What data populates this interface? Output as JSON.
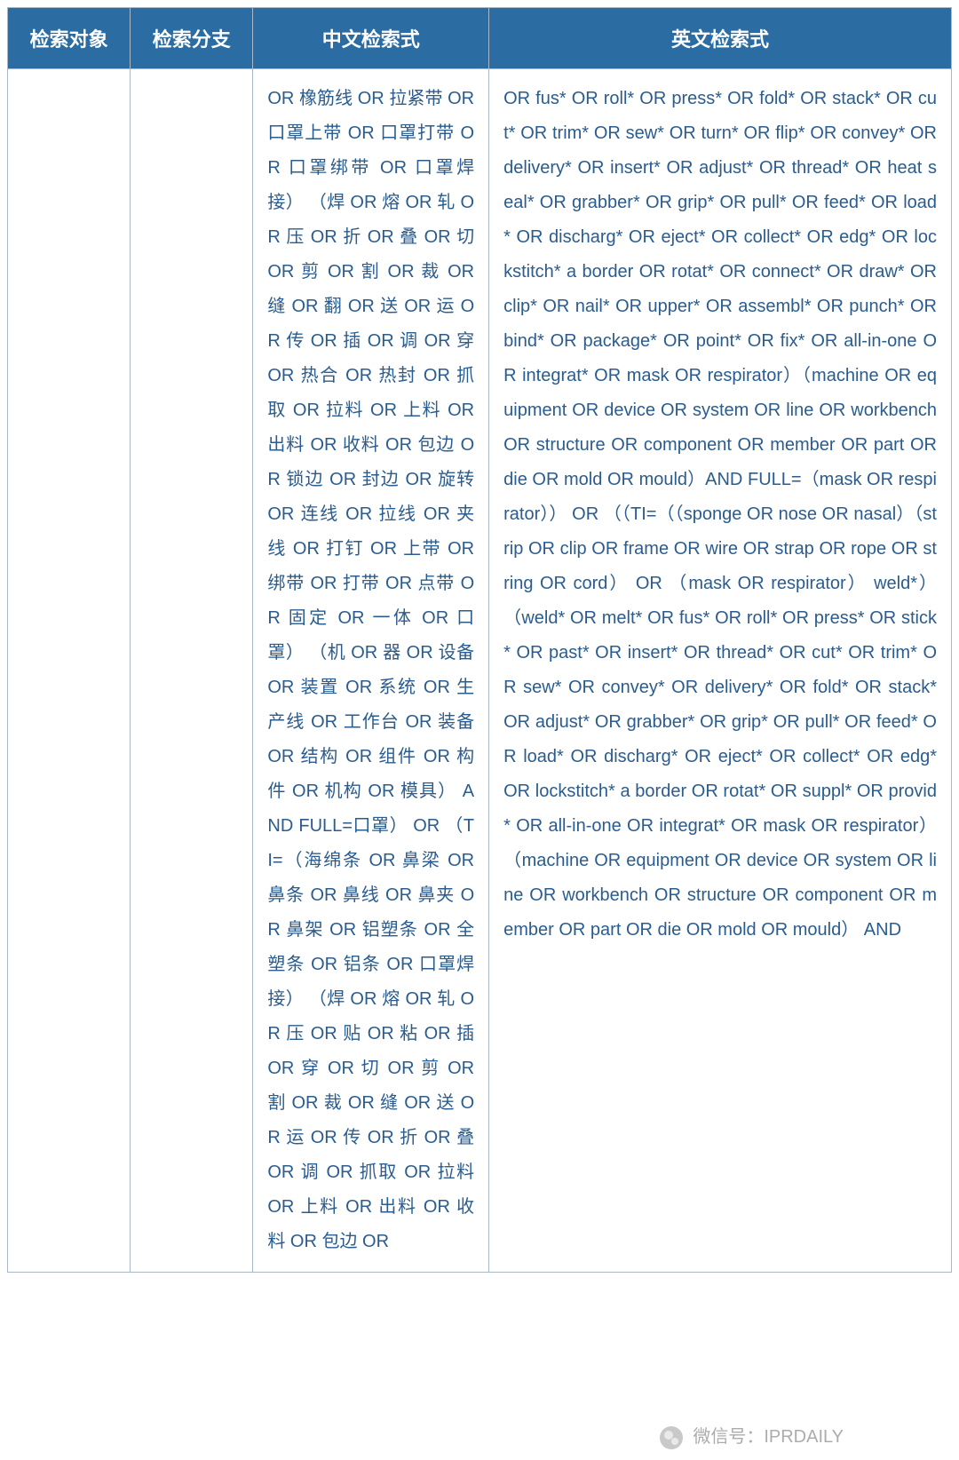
{
  "headers": {
    "col1": "检索对象",
    "col2": "检索分支",
    "col3": "中文检索式",
    "col4": "英文检索式"
  },
  "content": {
    "col1": "",
    "col2": "",
    "col3": "OR 橡筋线 OR 拉紧带 OR 口罩上带 OR 口罩打带 OR 口罩绑带 OR 口罩焊接） （焊 OR 熔 OR 轧 OR 压 OR 折 OR 叠 OR 切 OR 剪 OR 割 OR 裁 OR 缝 OR 翻 OR 送 OR 运 OR 传 OR 插 OR 调 OR 穿 OR 热合 OR 热封 OR 抓取 OR 拉料 OR 上料 OR 出料 OR 收料 OR 包边 OR 锁边 OR 封边 OR 旋转 OR 连线 OR 拉线 OR 夹线 OR 打钉 OR 上带 OR 绑带 OR 打带 OR 点带 OR 固定 OR 一体 OR 口罩） （机 OR 器 OR 设备 OR 装置 OR 系统 OR 生产线 OR 工作台 OR 装备 OR 结构 OR 组件 OR 构件 OR 机构 OR 模具） AND FULL=口罩） OR （TI=（海绵条 OR 鼻梁 OR 鼻条 OR 鼻线 OR 鼻夹 OR 鼻架 OR 铝塑条 OR 全塑条 OR 铝条 OR 口罩焊接） （焊 OR 熔 OR 轧 OR 压 OR 贴 OR 粘 OR 插 OR 穿 OR 切 OR 剪 OR 割 OR 裁 OR 缝 OR 送 OR 运 OR 传 OR 折 OR 叠 OR 调 OR 抓取 OR 拉料 OR 上料 OR 出料 OR 收料 OR 包边 OR",
    "col4": "OR fus* OR roll* OR press* OR fold* OR stack* OR cut* OR trim* OR sew* OR turn* OR flip* OR convey* OR delivery* OR insert* OR adjust* OR thread* OR heat seal* OR grabber* OR grip* OR pull* OR feed* OR load* OR discharg* OR eject* OR collect* OR edg* OR lockstitch* a border OR rotat* OR connect* OR draw* OR clip* OR nail* OR upper* OR assembl* OR punch* OR bind* OR package* OR point* OR fix* OR all-in-one OR integrat* OR mask OR respirator）（machine OR equipment OR device OR system OR line OR workbench OR structure OR component OR member OR part OR die OR mold OR mould）AND FULL=（mask OR respirator）） OR （（TI=（（sponge OR nose OR nasal）（strip OR clip OR frame OR wire OR strap OR rope OR string OR cord） OR （mask OR respirator） weld*） （weld* OR melt* OR fus* OR roll* OR press* OR stick* OR past* OR insert* OR thread* OR cut* OR trim* OR sew* OR convey* OR delivery* OR fold* OR stack* OR adjust* OR grabber* OR grip* OR pull* OR feed* OR load* OR discharg* OR eject* OR collect* OR edg* OR lockstitch* a border OR rotat* OR suppl* OR provid* OR all-in-one OR integrat* OR mask OR respirator） （machine OR equipment OR device OR system OR line OR workbench OR structure OR component OR member OR part OR die OR mold OR mould） AND"
  },
  "watermark": "微信号：IPRDAILY"
}
